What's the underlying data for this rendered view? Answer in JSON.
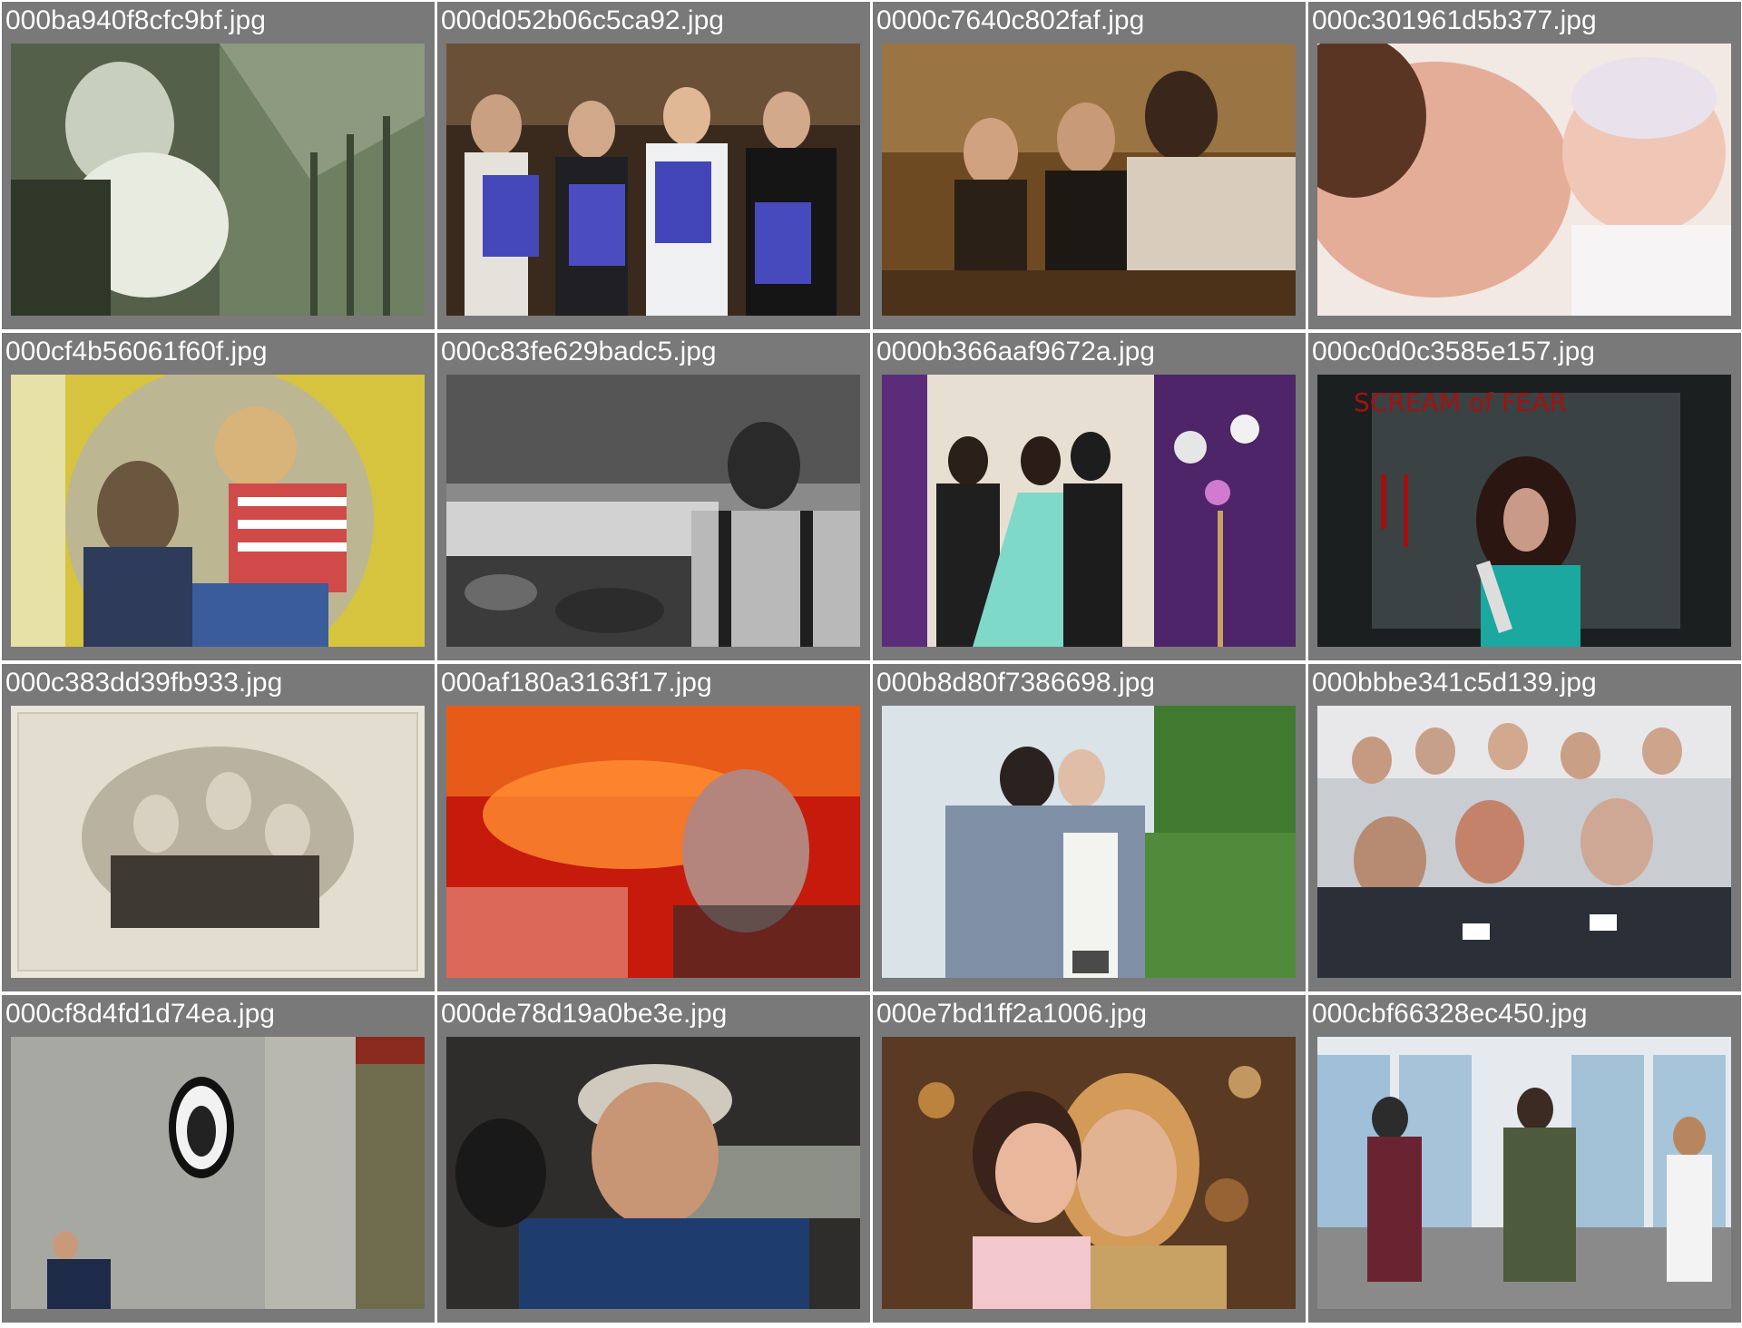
{
  "grid": {
    "items": [
      {
        "filename": "000ba940f8cfc9bf.jpg"
      },
      {
        "filename": "000d052b06c5ca92.jpg"
      },
      {
        "filename": "0000c7640c802faf.jpg"
      },
      {
        "filename": "000c301961d5b377.jpg"
      },
      {
        "filename": "000cf4b56061f60f.jpg"
      },
      {
        "filename": "000c83fe629badc5.jpg"
      },
      {
        "filename": "0000b366aaf9672a.jpg"
      },
      {
        "filename": "000c0d0c3585e157.jpg"
      },
      {
        "filename": "000c383dd39fb933.jpg"
      },
      {
        "filename": "000af180a3163f17.jpg"
      },
      {
        "filename": "000b8d80f7386698.jpg"
      },
      {
        "filename": "000bbbe341c5d139.jpg"
      },
      {
        "filename": "000cf8d4fd1d74ea.jpg"
      },
      {
        "filename": "000de78d19a0be3e.jpg"
      },
      {
        "filename": "000e7bd1ff2a1006.jpg"
      },
      {
        "filename": "000cbf66328ec450.jpg"
      }
    ]
  },
  "colors": {
    "cell_background": "#797979",
    "label_text": "#ffffff",
    "page_background": "#ffffff"
  }
}
